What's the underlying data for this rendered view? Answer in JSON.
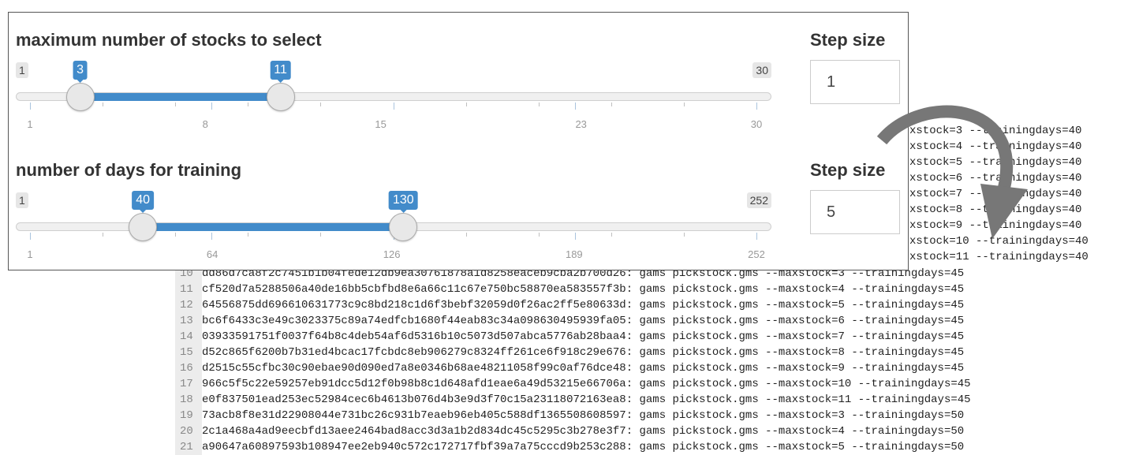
{
  "code_right_lines": [
    "xstock=3 --trainingdays=40",
    "xstock=4 --trainingdays=40",
    "xstock=5 --trainingdays=40",
    "xstock=6 --trainingdays=40",
    "xstock=7 --trainingdays=40",
    "xstock=8 --trainingdays=40",
    "xstock=9 --trainingdays=40",
    "xstock=10 --trainingdays=40",
    "xstock=11 --trainingdays=40"
  ],
  "code_lines": [
    {
      "num": "10",
      "text": "dd86d7ca8f2c7451b1b04fede12db9ea30761878a1d8258eaceb9cba2b700d26: gams pickstock.gms --maxstock=3 --trainingdays=45"
    },
    {
      "num": "11",
      "text": "cf520d7a5288506a40de16bb5cbfbd8e6a66c11c67e750bc58870ea583557f3b: gams pickstock.gms --maxstock=4 --trainingdays=45"
    },
    {
      "num": "12",
      "text": "64556875dd696610631773c9c8bd218c1d6f3bebf32059d0f26ac2ff5e80633d: gams pickstock.gms --maxstock=5 --trainingdays=45"
    },
    {
      "num": "13",
      "text": "bc6f6433c3e49c3023375c89a74edfcb1680f44eab83c34a098630495939fa05: gams pickstock.gms --maxstock=6 --trainingdays=45"
    },
    {
      "num": "14",
      "text": "03933591751f0037f64b8c4deb54af6d5316b10c5073d507abca5776ab28baa4: gams pickstock.gms --maxstock=7 --trainingdays=45"
    },
    {
      "num": "15",
      "text": "d52c865f6200b7b31ed4bcac17fcbdc8eb906279c8324ff261ce6f918c29e676: gams pickstock.gms --maxstock=8 --trainingdays=45"
    },
    {
      "num": "16",
      "text": "d2515c55cfbc30c90ebae90d090ed7a8e0346b68ae48211058f99c0af76dce48: gams pickstock.gms --maxstock=9 --trainingdays=45"
    },
    {
      "num": "17",
      "text": "966c5f5c22e59257eb91dcc5d12f0b98b8c1d648afd1eae6a49d53215e66706a: gams pickstock.gms --maxstock=10 --trainingdays=45"
    },
    {
      "num": "18",
      "text": "e0f837501ead253ec52984cec6b4613b076d4b3e9d3f70c15a23118072163ea8: gams pickstock.gms --maxstock=11 --trainingdays=45"
    },
    {
      "num": "19",
      "text": "73acb8f8e31d22908044e731bc26c931b7eaeb96eb405c588df1365508608597: gams pickstock.gms --maxstock=3 --trainingdays=50"
    },
    {
      "num": "20",
      "text": "2c1a468a4ad9eecbfd13aee2464bad8acc3d3a1b2d834dc45c5295c3b278e3f7: gams pickstock.gms --maxstock=4 --trainingdays=50"
    },
    {
      "num": "21",
      "text": "a90647a60897593b108947ee2eb940c572c172717fbf39a7a75cccd9b253c288: gams pickstock.gms --maxstock=5 --trainingdays=50"
    }
  ],
  "sliders": [
    {
      "title": "maximum number of stocks to select",
      "min": 1,
      "max": 30,
      "from": 3,
      "to": 11,
      "min_label": "1",
      "max_label": "30",
      "from_label": "3",
      "to_label": "11",
      "tick_values": [
        1,
        8,
        15,
        23,
        30
      ],
      "tick_labels": [
        "1",
        "8",
        "15",
        "23",
        "30"
      ],
      "step_label": "Step size",
      "step_value": "1"
    },
    {
      "title": "number of days for training",
      "min": 1,
      "max": 252,
      "from": 40,
      "to": 130,
      "min_label": "1",
      "max_label": "252",
      "from_label": "40",
      "to_label": "130",
      "tick_values": [
        1,
        64,
        126,
        189,
        252
      ],
      "tick_labels": [
        "1",
        "64",
        "126",
        "189",
        "252"
      ],
      "step_label": "Step size",
      "step_value": "5"
    }
  ],
  "colors": {
    "accent": "#428bca",
    "arrow": "#777777"
  }
}
